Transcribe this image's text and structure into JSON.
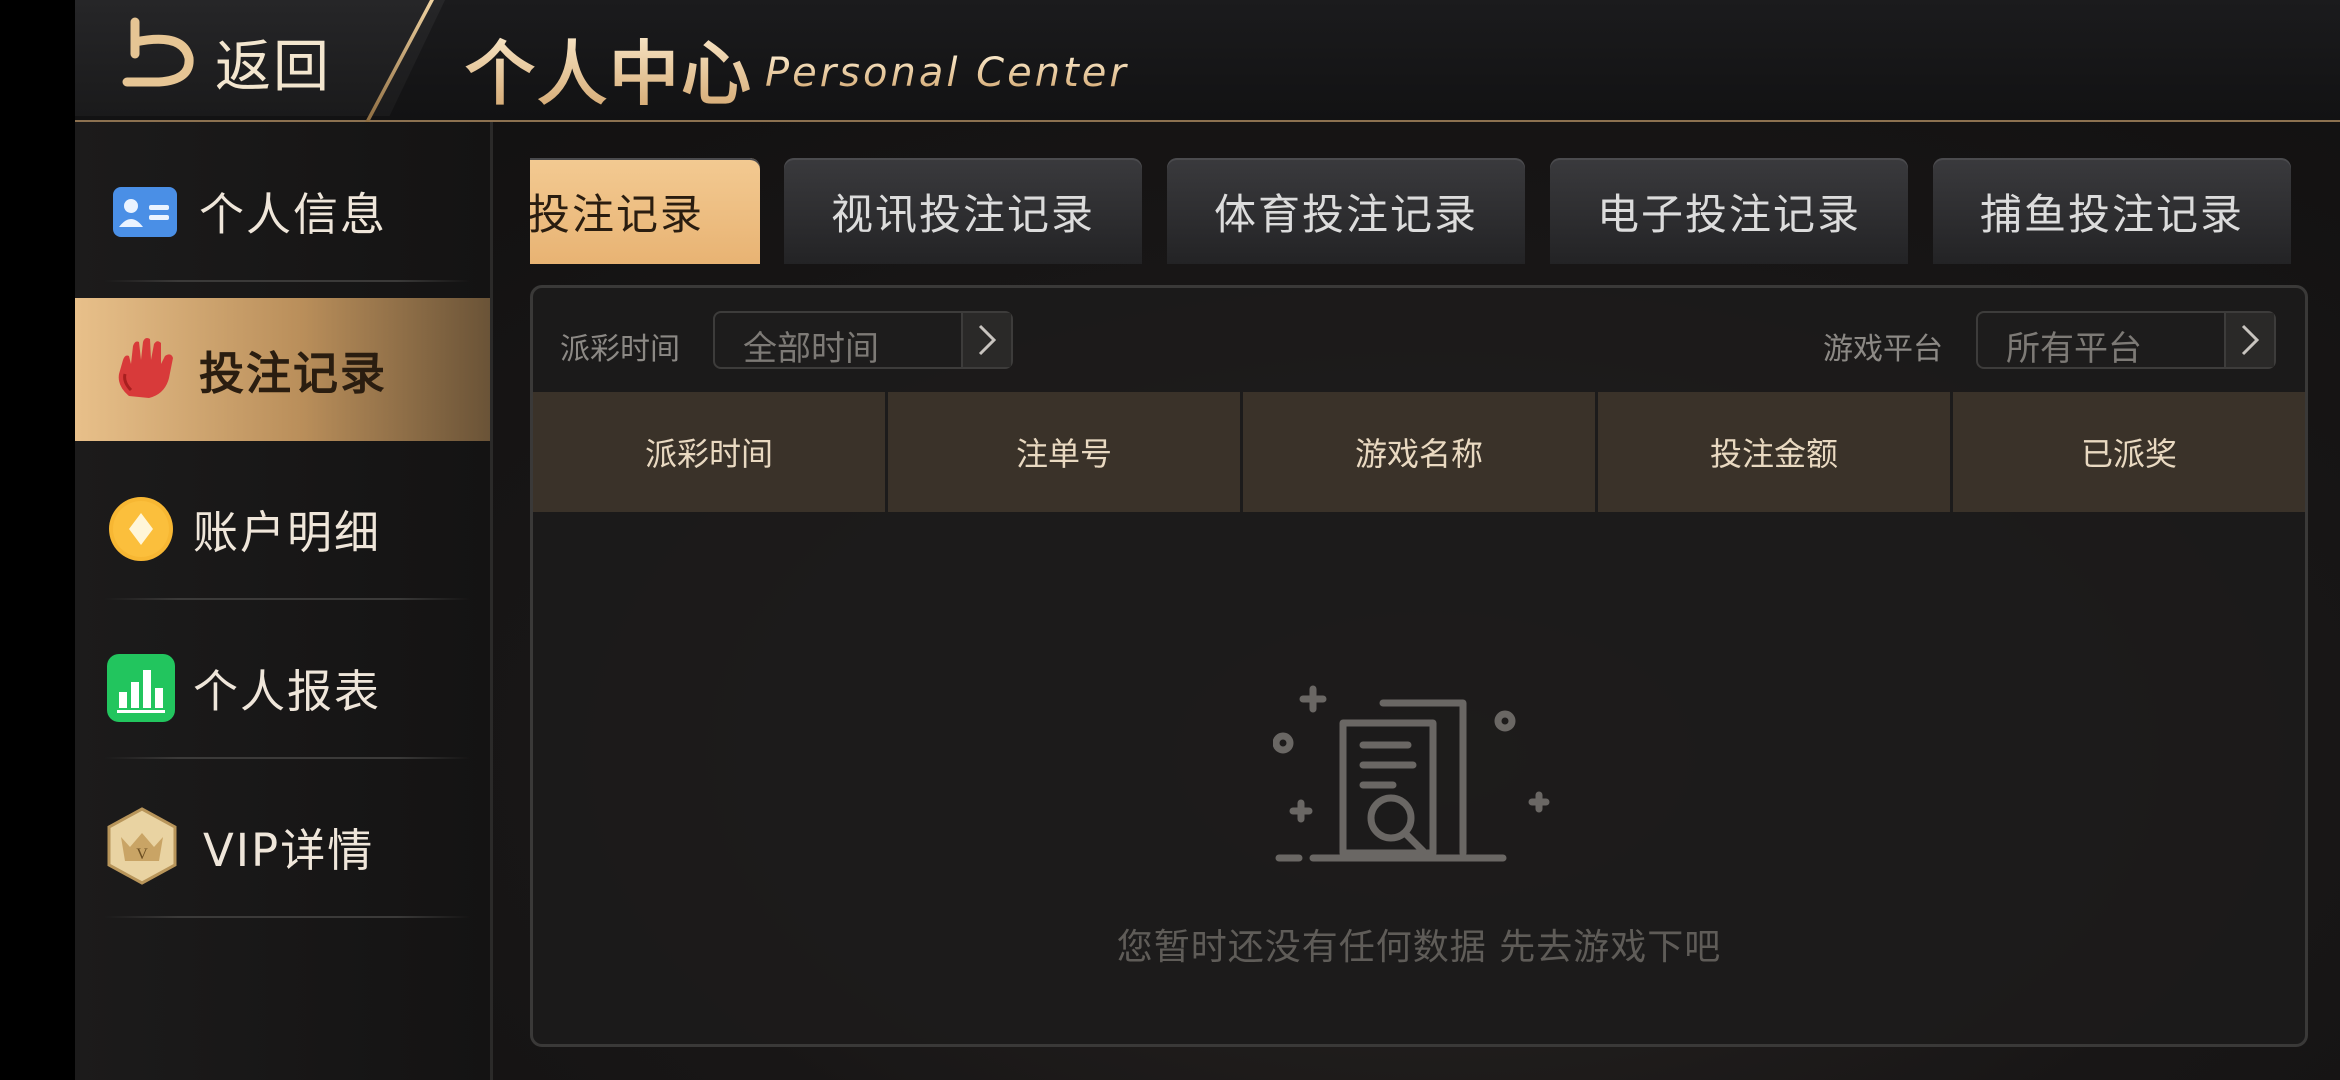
{
  "header": {
    "back_label": "返回",
    "title": "个人中心",
    "subtitle": "Personal Center"
  },
  "sidebar": {
    "items": [
      {
        "label": "个人信息",
        "icon": "id-card-icon"
      },
      {
        "label": "投注记录",
        "icon": "hand-icon",
        "active": true
      },
      {
        "label": "账户明细",
        "icon": "coin-icon"
      },
      {
        "label": "个人报表",
        "icon": "bar-chart-icon"
      },
      {
        "label": "VIP详情",
        "icon": "vip-crown-icon"
      }
    ]
  },
  "tabs": [
    {
      "label": "牌投注记录",
      "active": true
    },
    {
      "label": "视讯投注记录"
    },
    {
      "label": "体育投注记录"
    },
    {
      "label": "电子投注记录"
    },
    {
      "label": "捕鱼投注记录"
    }
  ],
  "filters": {
    "time_label": "派彩时间",
    "time_value": "全部时间",
    "platform_label": "游戏平台",
    "platform_value": "所有平台"
  },
  "table": {
    "columns": [
      "派彩时间",
      "注单号",
      "游戏名称",
      "投注金额",
      "已派奖"
    ],
    "rows": []
  },
  "empty_state": {
    "message": "您暂时还没有任何数据 先去游戏下吧"
  },
  "colors": {
    "accent_gold": "#e8b373",
    "header_border": "#8c7150",
    "table_header_bg": "#3a3229"
  }
}
